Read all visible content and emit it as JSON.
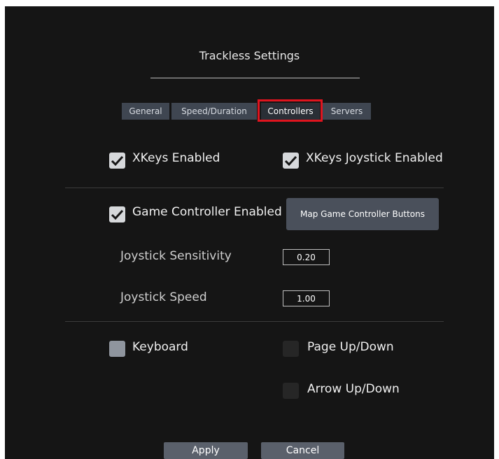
{
  "window": {
    "title": "Trackless Settings"
  },
  "tabs": [
    {
      "label": "General"
    },
    {
      "label": "Speed/Duration"
    },
    {
      "label": "Controllers",
      "active": true
    },
    {
      "label": "Servers"
    }
  ],
  "xkeys": {
    "enabled_label": "XKeys Enabled",
    "enabled_checked": true,
    "joystick_label": "XKeys Joystick Enabled",
    "joystick_checked": true
  },
  "game_controller": {
    "enabled_label": "Game Controller Enabled",
    "enabled_checked": true,
    "map_button_label": "Map Game Controller Buttons",
    "sensitivity_label": "Joystick Sensitivity",
    "sensitivity_value": "0.20",
    "speed_label": "Joystick Speed",
    "speed_value": "1.00"
  },
  "keyboard": {
    "label": "Keyboard",
    "checked": false,
    "page_label": "Page Up/Down",
    "page_checked": false,
    "arrow_label": "Arrow Up/Down",
    "arrow_checked": false
  },
  "footer": {
    "apply_label": "Apply",
    "cancel_label": "Cancel"
  },
  "colors": {
    "panel": "#151515",
    "tab": "#3f4651",
    "highlight": "#e0141e",
    "accent": "#e07a2a"
  },
  "icons": [
    "checkmark-icon"
  ]
}
